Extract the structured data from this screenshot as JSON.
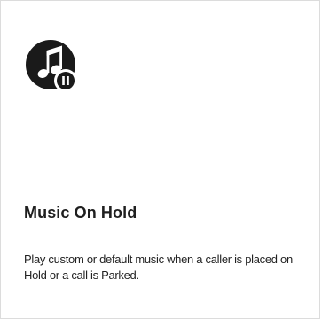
{
  "card": {
    "icon": "music-note-pause-icon",
    "title": "Music On Hold",
    "description": "Play custom or default music when a caller is placed on Hold or a call is Parked."
  },
  "colors": {
    "icon_dark": "#1a1a1a",
    "icon_light": "#ffffff",
    "border": "#dcdcdc",
    "divider": "#333333",
    "text": "#222222"
  }
}
